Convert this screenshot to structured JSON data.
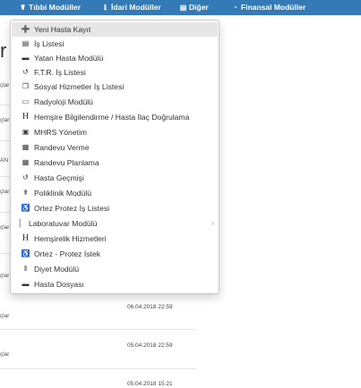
{
  "navbar": {
    "items": [
      {
        "label": "Tıbbi Modüller",
        "icon": "stethoscope-icon",
        "glyph": "☤"
      },
      {
        "label": "İdari Modüller",
        "icon": "info-icon",
        "glyph": "ℹ"
      },
      {
        "label": "Diğer",
        "icon": "list-icon",
        "glyph": "▤"
      },
      {
        "label": "Finansal Modüller",
        "icon": "gauge-icon",
        "glyph": "◔"
      }
    ]
  },
  "page": {
    "heading": "r",
    "fragments": [
      "çlar",
      "çlar",
      "AN",
      "çlar",
      "çlar",
      "çlar",
      "çlar",
      "çlar"
    ],
    "dates": [
      "06.04.2018 22:59",
      "05.04.2018 22:59",
      "05.04.2018 15:21"
    ]
  },
  "dropdown": {
    "items": [
      {
        "label": "Yeni Hasta Kayıt",
        "icon": "user-plus-icon",
        "glyph": "👤"
      },
      {
        "label": "İş Listesi",
        "icon": "list-alt-icon",
        "glyph": "▤"
      },
      {
        "label": "Yatan Hasta Modülü",
        "icon": "bed-icon",
        "glyph": "▬"
      },
      {
        "label": "F.T.R. İş Listesi",
        "icon": "undo-icon",
        "glyph": "↺"
      },
      {
        "label": "Sosyal Hizmetler İş Listesi",
        "icon": "copy-icon",
        "glyph": "❐"
      },
      {
        "label": "Radyoloji Modülü",
        "icon": "desktop-icon",
        "glyph": "▭"
      },
      {
        "label": "Hemşire Bilgilendirme / Hasta İlaç Doğrulama",
        "icon": "hospital-h-icon",
        "glyph": "H"
      },
      {
        "label": "MHRS Yönetim",
        "icon": "id-card-icon",
        "glyph": "▣"
      },
      {
        "label": "Randevu Verme",
        "icon": "calendar-check-icon",
        "glyph": "▦"
      },
      {
        "label": "Randevu Planlama",
        "icon": "calendar-icon",
        "glyph": "▦"
      },
      {
        "label": "Hasta Geçmişi",
        "icon": "history-icon",
        "glyph": "↺"
      },
      {
        "label": "Poliklinik Modülü",
        "icon": "stethoscope-icon",
        "glyph": "☤"
      },
      {
        "label": "Ortez Protez İş Listesi",
        "icon": "wheelchair-icon",
        "glyph": "♿"
      },
      {
        "label": "Laboratuvar Modülü",
        "icon": "thermometer-icon",
        "glyph": "🌡",
        "caret": "›"
      },
      {
        "label": "Hemşirelik Hizmetleri",
        "icon": "hospital-h-icon",
        "glyph": "H"
      },
      {
        "label": "Ortez - Protez İstek",
        "icon": "accessibility-icon",
        "glyph": "♿"
      },
      {
        "label": "Diyet Modülü",
        "icon": "cutlery-icon",
        "glyph": "🍴"
      },
      {
        "label": "Hasta Dosyası",
        "icon": "folder-icon",
        "glyph": "▬"
      }
    ]
  }
}
